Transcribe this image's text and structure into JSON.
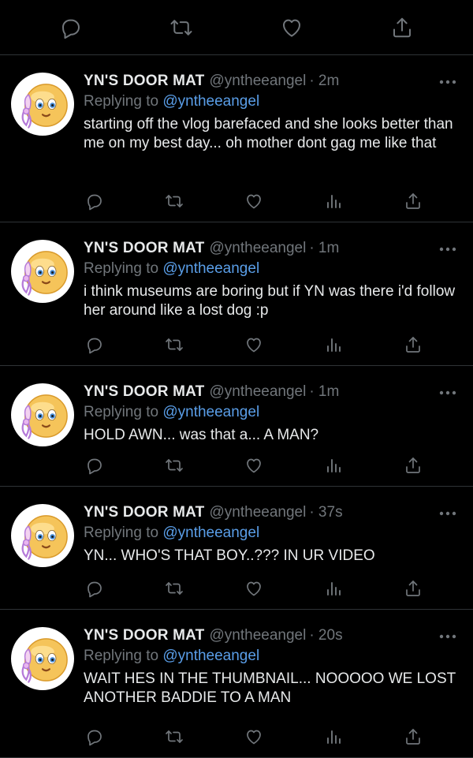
{
  "colors": {
    "background": "#000000",
    "text": "#e7e9ea",
    "muted": "#71767b",
    "mention": "#5a9ee8",
    "divider": "#2f3336",
    "avatar_face": "#f5c45a"
  },
  "top_actions": [
    "reply-icon",
    "retweet-icon",
    "like-icon",
    "share-icon"
  ],
  "tweets": [
    {
      "name": "YN'S  DOOR MAT",
      "handle": "@yntheeangel",
      "time": "· 2m",
      "replying_prefix": "Replying to",
      "replying_to": "@yntheeangel",
      "text": "starting off the vlog barefaced and she looks better than me on my best day... oh mother dont gag me like that"
    },
    {
      "name": "YN'S  DOOR MAT",
      "handle": "@yntheeangel",
      "time": "· 1m",
      "replying_prefix": "Replying to",
      "replying_to": "@yntheeangel",
      "text": "i think museums are boring but if YN was there i'd follow her around like a lost dog :p"
    },
    {
      "name": "YN'S  DOOR MAT",
      "handle": "@yntheeangel",
      "time": "· 1m",
      "replying_prefix": "Replying to",
      "replying_to": "@yntheeangel",
      "text": "HOLD AWN... was that a... A MAN?"
    },
    {
      "name": "YN'S  DOOR MAT",
      "handle": "@yntheeangel",
      "time": "· 37s",
      "replying_prefix": "Replying to",
      "replying_to": "@yntheeangel",
      "text": "YN... WHO'S THAT BOY..??? IN UR VIDEO"
    },
    {
      "name": "YN'S  DOOR MAT",
      "handle": "@yntheeangel",
      "time": "· 20s",
      "replying_prefix": "Replying to",
      "replying_to": "@yntheeangel",
      "text": "WAIT HES IN THE THUMBNAIL... NOOOOO WE LOST ANOTHER BADDIE TO A MAN"
    }
  ],
  "tweet_action_icons": [
    "reply-icon",
    "retweet-icon",
    "like-icon",
    "analytics-icon",
    "share-icon"
  ]
}
